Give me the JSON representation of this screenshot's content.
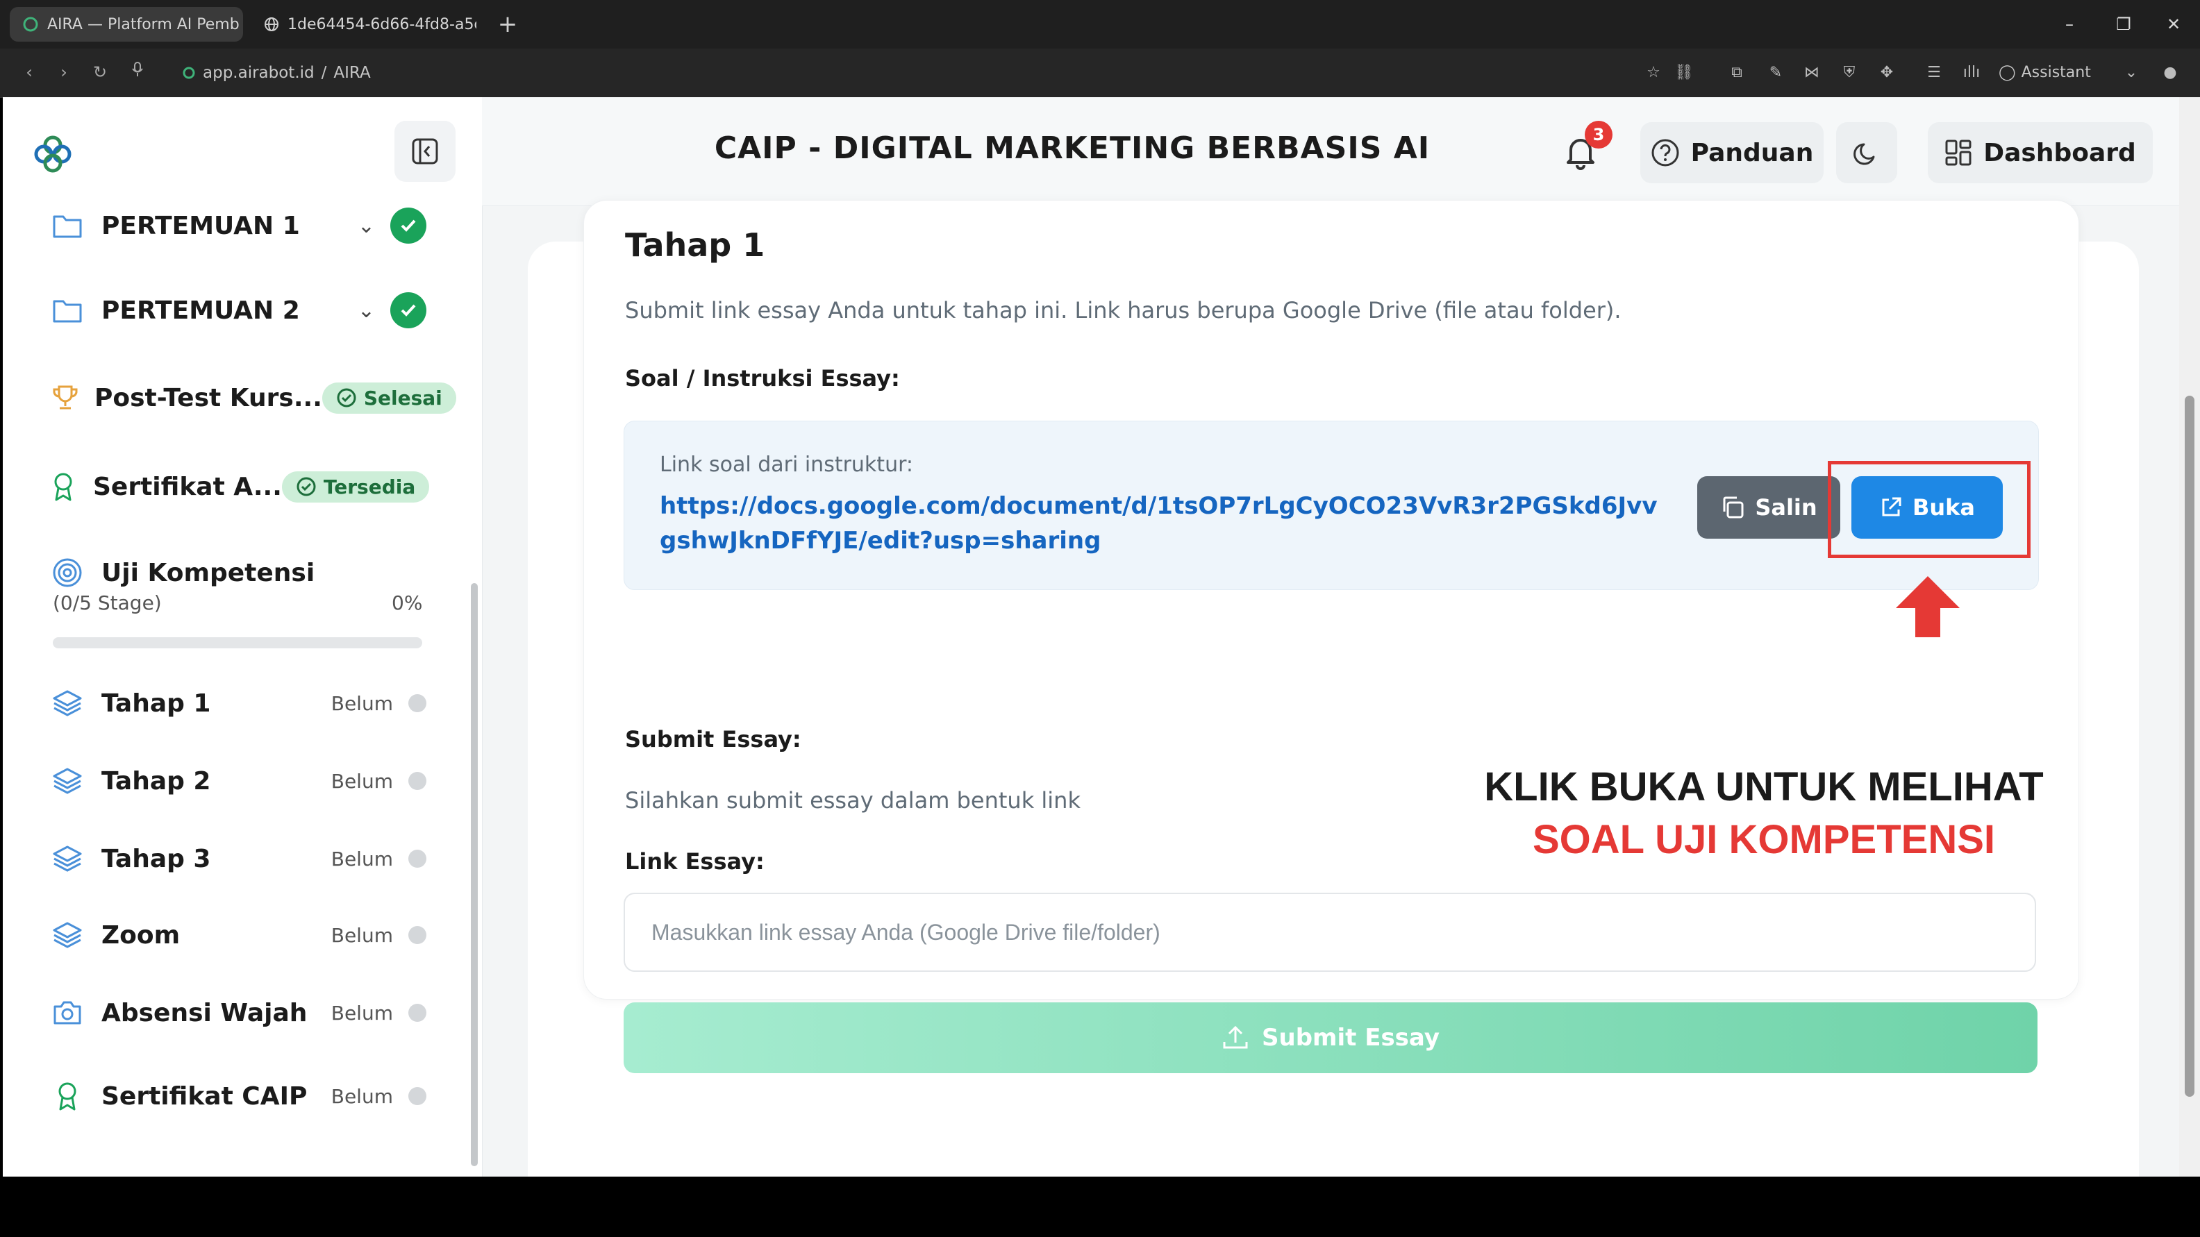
{
  "browser": {
    "tabs": [
      {
        "title": "AIRA — Platform AI Pemb"
      },
      {
        "title": "1de64454-6d66-4fd8-a5c"
      }
    ],
    "new_tab": "+",
    "url_host": "app.airabot.id",
    "url_sep": "/",
    "url_path": "AIRA",
    "assistant_label": "Assistant",
    "window_controls": {
      "minimize": "–",
      "restore": "❐",
      "close": "✕"
    }
  },
  "sidebar": {
    "items": [
      {
        "label": "PERTEMUAN 1",
        "icon": "folder-icon",
        "done": true
      },
      {
        "label": "PERTEMUAN 2",
        "icon": "folder-icon",
        "done": true
      },
      {
        "label": "Post-Test Kurs...",
        "icon": "trophy-icon",
        "badge": "Selesai"
      },
      {
        "label": "Sertifikat A...",
        "icon": "award-icon",
        "badge": "Tersedia"
      }
    ],
    "uji": {
      "label": "Uji Kompetensi",
      "stages": "(0/5 Stage)",
      "percent": "0%",
      "progress": 0
    },
    "stages": [
      {
        "label": "Tahap 1",
        "icon": "layers-icon",
        "status": "Belum"
      },
      {
        "label": "Tahap 2",
        "icon": "layers-icon",
        "status": "Belum"
      },
      {
        "label": "Tahap 3",
        "icon": "layers-icon",
        "status": "Belum"
      },
      {
        "label": "Zoom",
        "icon": "layers-icon",
        "status": "Belum"
      },
      {
        "label": "Absensi Wajah",
        "icon": "camera-icon",
        "status": "Belum"
      },
      {
        "label": "Sertifikat CAIP",
        "icon": "award-icon",
        "status": "Belum"
      }
    ]
  },
  "header": {
    "title": "CAIP - DIGITAL MARKETING BERBASIS AI",
    "notification_count": "3",
    "guide_label": "Panduan",
    "dashboard_label": "Dashboard"
  },
  "main": {
    "stage_title": "Tahap 1",
    "stage_desc": "Submit link essay Anda untuk tahap ini. Link harus berupa Google Drive (file atau folder).",
    "soal_label": "Soal / Instruksi Essay:",
    "link_caption": "Link soal dari instruktur:",
    "link_url": "https://docs.google.com/document/d/1tsOP7rLgCyOCO23VvR3r2PGSkd6JvvgshwJknDFfYJE/edit?usp=sharing",
    "copy_label": "Salin",
    "open_label": "Buka",
    "submit_label": "Submit Essay:",
    "submit_desc": "Silahkan submit essay dalam bentuk link",
    "link_essay_label": "Link Essay:",
    "essay_placeholder": "Masukkan link essay Anda (Google Drive file/folder)",
    "submit_button": "Submit Essay"
  },
  "annotation": {
    "line1": "KLIK BUKA UNTUK MELIHAT",
    "line2": "SOAL UJI KOMPETENSI"
  },
  "colors": {
    "accent_blue": "#1e88e5",
    "success_green": "#1aa35a",
    "annotation_red": "#e53935"
  }
}
